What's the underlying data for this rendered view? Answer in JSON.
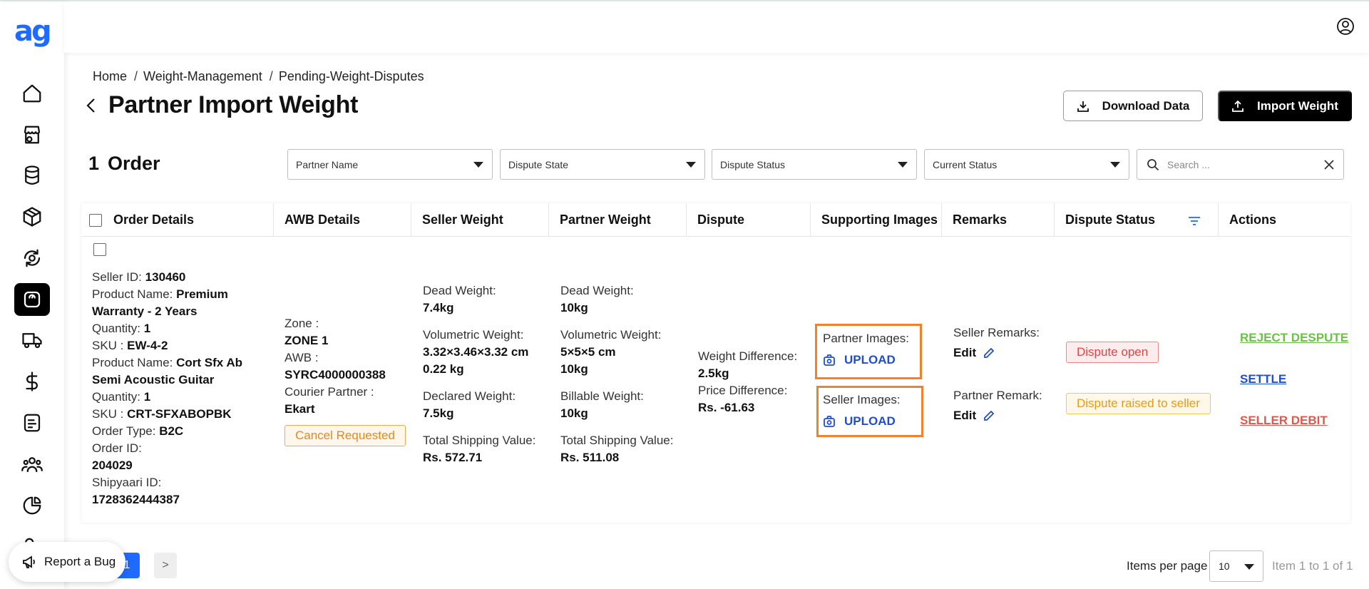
{
  "logo": "ag",
  "breadcrumb": [
    "Home",
    "Weight-Management",
    "Pending-Weight-Disputes"
  ],
  "page_title": "Partner Import Weight",
  "buttons": {
    "download": "Download Data",
    "import": "Import Weight"
  },
  "order_count": {
    "num": "1",
    "label": "Order"
  },
  "filters": {
    "partner_name": "Partner Name",
    "dispute_state": "Dispute State",
    "dispute_status": "Dispute Status",
    "current_status": "Current Status",
    "search_placeholder": "Search ..."
  },
  "columns": [
    "Order Details",
    "AWB Details",
    "Seller Weight",
    "Partner Weight",
    "Dispute",
    "Supporting Images",
    "Remarks",
    "Dispute Status",
    "Actions"
  ],
  "row": {
    "order": {
      "seller_id_label": "Seller ID:",
      "seller_id": "130460",
      "product1_label": "Product Name:",
      "product1_a": "Premium",
      "product1_b": "Warranty - 2 Years",
      "qty1_label": "Quantity:",
      "qty1": "1",
      "sku1_label": "SKU :",
      "sku1": "EW-4-2",
      "product2_label": "Product Name:",
      "product2_a": "Cort Sfx Ab",
      "product2_b": "Semi Acoustic Guitar",
      "qty2_label": "Quantity:",
      "qty2": "1",
      "sku2_label": "SKU :",
      "sku2": "CRT-SFXABOPBK",
      "order_type_label": "Order Type:",
      "order_type": "B2C",
      "order_id_label": "Order ID:",
      "order_id": "204029",
      "shipyaari_label": "Shipyaari ID:",
      "shipyaari_id": "1728362444387"
    },
    "awb": {
      "zone_label": "Zone :",
      "zone": "ZONE 1",
      "awb_label": "AWB :",
      "awb": "SYRC4000000388",
      "courier_label": "Courier Partner :",
      "courier": "Ekart",
      "status_badge": "Cancel Requested"
    },
    "seller_weight": {
      "dead_label": "Dead Weight:",
      "dead": "7.4kg",
      "vol_label": "Volumetric Weight:",
      "vol_dims": "3.32×3.46×3.32 cm",
      "vol": "0.22 kg",
      "declared_label": "Declared Weight:",
      "declared": "7.5kg",
      "tsv_label": "Total Shipping Value:",
      "tsv": "Rs. 572.71"
    },
    "partner_weight": {
      "dead_label": "Dead Weight:",
      "dead": "10kg",
      "vol_label": "Volumetric Weight:",
      "vol_dims": "5×5×5 cm",
      "vol": "10kg",
      "billable_label": "Billable Weight:",
      "billable": "10kg",
      "tsv_label": "Total Shipping Value:",
      "tsv": "Rs. 511.08"
    },
    "dispute": {
      "wd_label": "Weight Difference:",
      "wd": "2.5kg",
      "pd_label": "Price Difference:",
      "pd": "Rs. -61.63"
    },
    "images": {
      "partner_label": "Partner Images:",
      "partner_upload": "UPLOAD",
      "seller_label": "Seller Images:",
      "seller_upload": "UPLOAD"
    },
    "remarks": {
      "seller_label": "Seller Remarks:",
      "seller_edit": "Edit",
      "partner_label": "Partner Remark:",
      "partner_edit": "Edit"
    },
    "dispute_status": {
      "open": "Dispute open",
      "raised": "Dispute raised to seller"
    },
    "actions": {
      "reject": "REJECT DESPUTE",
      "settle": "SETTLE",
      "seller_debit": "SELLER DEBIT"
    }
  },
  "footer": {
    "report_bug": "Report a Bug",
    "page_current": "1",
    "page_next": ">",
    "items_per_page_label": "Items per page",
    "items_per_page": "10",
    "item_range": "Item 1 to 1 of 1"
  },
  "colors": {
    "accent": "#1f6bff",
    "highlight": "#f0822d",
    "reject": "#6cc04a",
    "settle": "#1f4fc9",
    "debit": "#e2574c"
  }
}
